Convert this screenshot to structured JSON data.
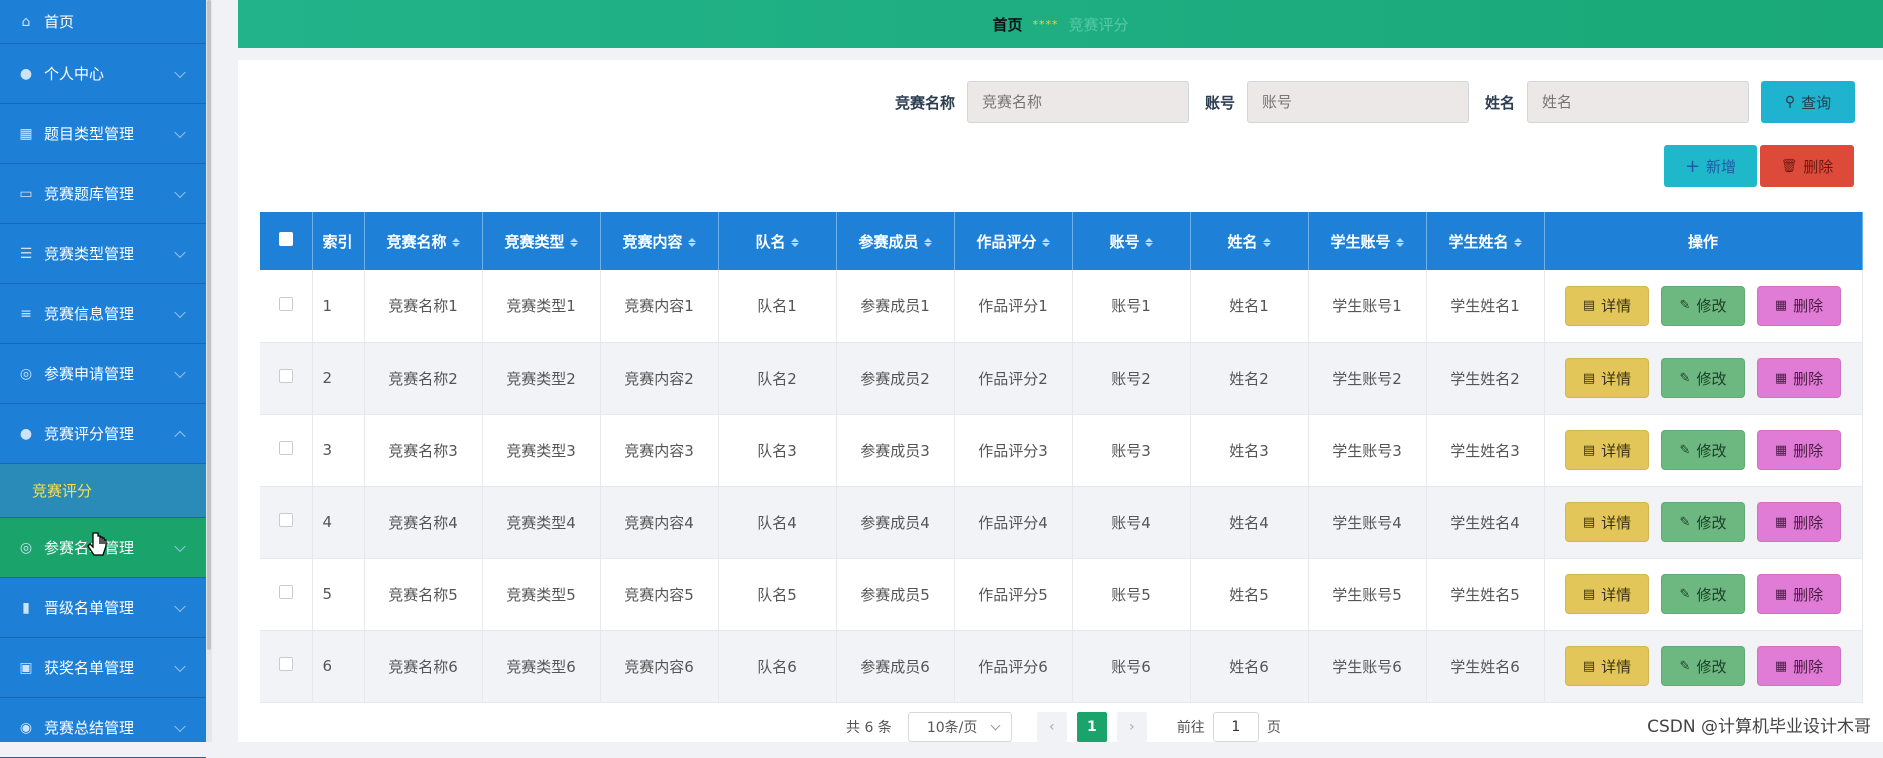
{
  "sidebar": {
    "items": [
      {
        "label": "首页",
        "icon": "home-icon"
      },
      {
        "label": "个人中心",
        "icon": "user-icon"
      },
      {
        "label": "题目类型管理",
        "icon": "grid-icon"
      },
      {
        "label": "竞赛题库管理",
        "icon": "chat-icon"
      },
      {
        "label": "竞赛类型管理",
        "icon": "sliders-icon"
      },
      {
        "label": "竞赛信息管理",
        "icon": "list-icon"
      },
      {
        "label": "参赛申请管理",
        "icon": "globe-icon"
      },
      {
        "label": "竞赛评分管理",
        "icon": "pin-icon"
      },
      {
        "label": "参赛名单管理",
        "icon": "globe-icon"
      },
      {
        "label": "晋级名单管理",
        "icon": "chart-icon"
      },
      {
        "label": "获奖名单管理",
        "icon": "badge-icon"
      },
      {
        "label": "竞赛总结管理",
        "icon": "compass-icon"
      }
    ],
    "sub_item": "竞赛评分"
  },
  "breadcrumb": {
    "home": "首页",
    "sep": "****",
    "current": "竞赛评分"
  },
  "search": {
    "name_label": "竞赛名称",
    "name_placeholder": "竞赛名称",
    "account_label": "账号",
    "account_placeholder": "账号",
    "realname_label": "姓名",
    "realname_placeholder": "姓名",
    "query_label": "查询"
  },
  "toolbar": {
    "add_label": "新增",
    "delete_label": "删除"
  },
  "table": {
    "headers": [
      "索引",
      "竞赛名称",
      "竞赛类型",
      "竞赛内容",
      "队名",
      "参赛成员",
      "作品评分",
      "账号",
      "姓名",
      "学生账号",
      "学生姓名",
      "操作"
    ],
    "rows": [
      [
        "1",
        "竞赛名称1",
        "竞赛类型1",
        "竞赛内容1",
        "队名1",
        "参赛成员1",
        "作品评分1",
        "账号1",
        "姓名1",
        "学生账号1",
        "学生姓名1"
      ],
      [
        "2",
        "竞赛名称2",
        "竞赛类型2",
        "竞赛内容2",
        "队名2",
        "参赛成员2",
        "作品评分2",
        "账号2",
        "姓名2",
        "学生账号2",
        "学生姓名2"
      ],
      [
        "3",
        "竞赛名称3",
        "竞赛类型3",
        "竞赛内容3",
        "队名3",
        "参赛成员3",
        "作品评分3",
        "账号3",
        "姓名3",
        "学生账号3",
        "学生姓名3"
      ],
      [
        "4",
        "竞赛名称4",
        "竞赛类型4",
        "竞赛内容4",
        "队名4",
        "参赛成员4",
        "作品评分4",
        "账号4",
        "姓名4",
        "学生账号4",
        "学生姓名4"
      ],
      [
        "5",
        "竞赛名称5",
        "竞赛类型5",
        "竞赛内容5",
        "队名5",
        "参赛成员5",
        "作品评分5",
        "账号5",
        "姓名5",
        "学生账号5",
        "学生姓名5"
      ],
      [
        "6",
        "竞赛名称6",
        "竞赛类型6",
        "竞赛内容6",
        "队名6",
        "参赛成员6",
        "作品评分6",
        "账号6",
        "姓名6",
        "学生账号6",
        "学生姓名6"
      ]
    ],
    "actions": {
      "detail": "详情",
      "edit": "修改",
      "delete": "删除"
    }
  },
  "pagination": {
    "total": "共 6 条",
    "page_size": "10条/页",
    "current": "1",
    "goto_label": "前往",
    "goto_value": "1",
    "page_suffix": "页"
  },
  "watermark": "CSDN @计算机毕业设计木哥",
  "colors": {
    "sidebar": "#1e7fd6",
    "header": "#1aa36b",
    "table_header": "#1e80d6"
  }
}
